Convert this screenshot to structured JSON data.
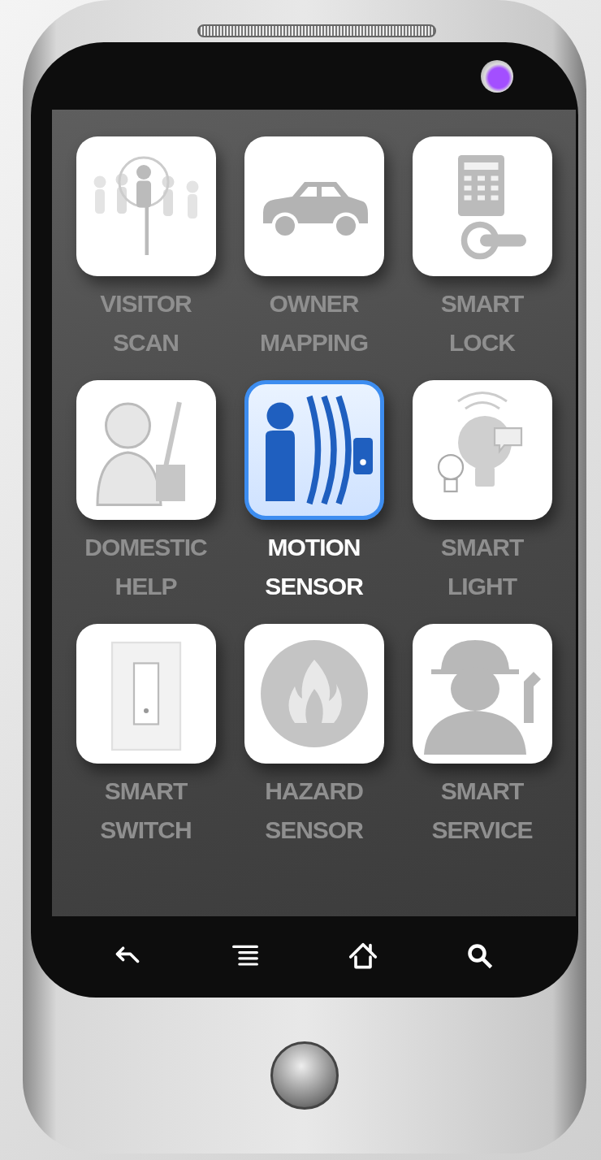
{
  "apps": [
    {
      "label": "VISITOR\nSCAN",
      "kind": "visitor",
      "selected": false
    },
    {
      "label": "OWNER\nMAPPING",
      "kind": "car",
      "selected": false
    },
    {
      "label": "SMART\nLOCK",
      "kind": "lock",
      "selected": false
    },
    {
      "label": "DOMESTIC\nHELP",
      "kind": "helper",
      "selected": false
    },
    {
      "label": "MOTION\nSENSOR",
      "kind": "motion",
      "selected": true
    },
    {
      "label": "SMART\nLIGHT",
      "kind": "bulb",
      "selected": false
    },
    {
      "label": "SMART\nSWITCH",
      "kind": "switch",
      "selected": false
    },
    {
      "label": "HAZARD\nSENSOR",
      "kind": "fire",
      "selected": false
    },
    {
      "label": "SMART\nSERVICE",
      "kind": "worker",
      "selected": false
    }
  ],
  "nav": [
    {
      "kind": "back"
    },
    {
      "kind": "menu"
    },
    {
      "kind": "home"
    },
    {
      "kind": "search"
    }
  ]
}
